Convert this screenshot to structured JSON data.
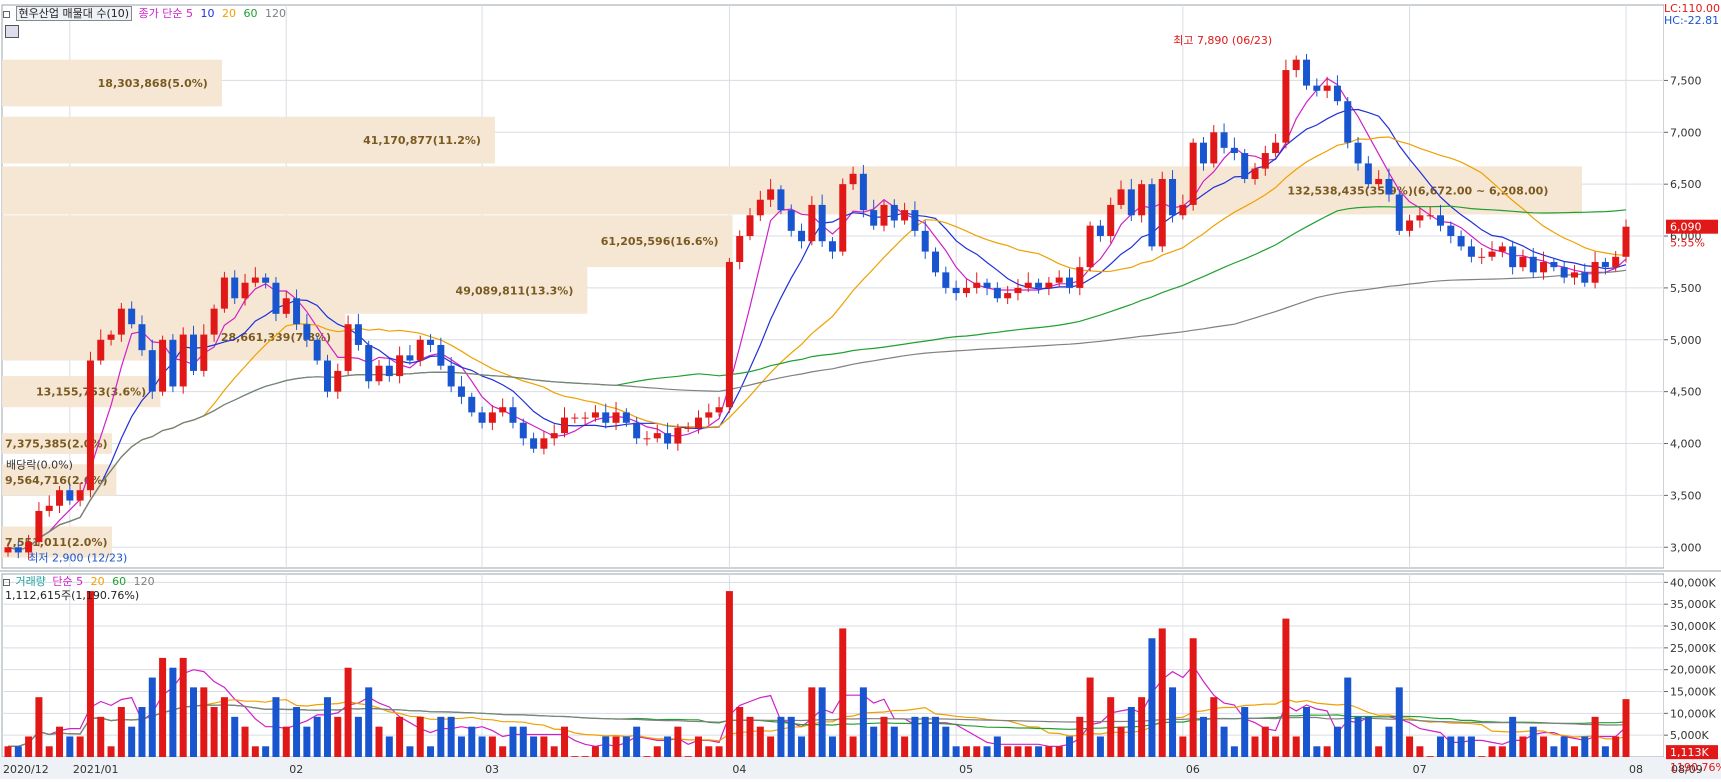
{
  "price_header": {
    "ticker": "현우산업 매물대 수(10)",
    "ma_label": "종가 단순",
    "ma_periods": [
      "5",
      "10",
      "20",
      "60",
      "120"
    ],
    "ma_colors": [
      "#d020c8",
      "#2030d8",
      "#f0a000",
      "#20a030",
      "#808080"
    ]
  },
  "volume_header": {
    "label": "거래량",
    "ma_label": "단순",
    "ma_periods": [
      "5",
      "20",
      "60",
      "120"
    ],
    "ma_colors": [
      "#d020c8",
      "#f0a000",
      "#20a030",
      "#808080"
    ],
    "last_value": "1,112,615주(1,190.76%)"
  },
  "right_top": {
    "lc": "LC:110.00",
    "hc": "HC:-22.81"
  },
  "annotations": {
    "high": "최고 7,890 (06/23)",
    "low": "최저 2,900 (12/23)",
    "dividend": "배당락(0.0%)"
  },
  "price_tag": {
    "value": "6,090",
    "pct": "5.55%"
  },
  "volume_tag": {
    "value": "1,113K",
    "pct": "1190.76%"
  },
  "x_labels": [
    "2020/12",
    "2021/01",
    "02",
    "03",
    "04",
    "05",
    "06",
    "07",
    "08",
    "08/09"
  ],
  "colors": {
    "up": "#e01818",
    "down": "#1a55d0",
    "band": "#f5e6d3",
    "grid": "#d8dde3"
  },
  "chart_data": {
    "type": "candlestick",
    "price_axis": {
      "ticks": [
        "3,000",
        "3,500",
        "4,000",
        "4,500",
        "5,000",
        "5,500",
        "6,000",
        "6,500",
        "7,000",
        "7,500"
      ],
      "range": [
        2800,
        8150
      ]
    },
    "volume_axis": {
      "ticks": [
        "5,000K",
        "10,000K",
        "15,000K",
        "20,000K",
        "25,000K",
        "30,000K",
        "35,000K",
        "40,000K"
      ],
      "range": [
        0,
        41000
      ]
    },
    "volume_profile": [
      {
        "label": "7,551,011(2.0%)",
        "low": 2900,
        "high": 3200,
        "pct": 2.0
      },
      {
        "label": "9,564,716(2.6%)",
        "low": 3500,
        "high": 3800,
        "pct": 2.6
      },
      {
        "label": "7,375,385(2.0%)",
        "low": 3900,
        "high": 4100,
        "pct": 2.0
      },
      {
        "label": "13,155,753(3.6%)",
        "low": 4350,
        "high": 4650,
        "pct": 3.6
      },
      {
        "label": "28,661,339(7.8%)",
        "low": 4800,
        "high": 5250,
        "pct": 7.8
      },
      {
        "label": "49,089,811(13.3%)",
        "low": 5250,
        "high": 5700,
        "pct": 13.3
      },
      {
        "label": "61,205,596(16.6%)",
        "low": 5700,
        "high": 6200,
        "pct": 16.6
      },
      {
        "label": "132,538,435(35.9%)(6,672.00 ~ 6,208.00)",
        "low": 6208,
        "high": 6672,
        "pct": 35.9
      },
      {
        "label": "41,170,877(11.2%)",
        "low": 6700,
        "high": 7150,
        "pct": 11.2
      },
      {
        "label": "18,303,868(5.0%)",
        "low": 7250,
        "high": 7700,
        "pct": 5.0
      }
    ],
    "prices": [
      3000,
      2950,
      3050,
      3350,
      3400,
      3550,
      3450,
      3550,
      4800,
      5000,
      5050,
      5300,
      5150,
      4900,
      4500,
      5000,
      4550,
      5050,
      4700,
      5050,
      5300,
      5600,
      5400,
      5550,
      5600,
      5550,
      5250,
      5400,
      5150,
      5000,
      4800,
      4500,
      4700,
      5150,
      4950,
      4600,
      4750,
      4650,
      4850,
      4800,
      5000,
      4950,
      4750,
      4550,
      4450,
      4300,
      4200,
      4300,
      4350,
      4200,
      4050,
      3950,
      4050,
      4100,
      4250,
      4250,
      4250,
      4300,
      4200,
      4300,
      4200,
      4050,
      4050,
      4100,
      4000,
      4150,
      4150,
      4250,
      4300,
      4350,
      5750,
      6000,
      6200,
      6350,
      6450,
      6250,
      6050,
      5950,
      6300,
      5950,
      5850,
      6500,
      6600,
      6250,
      6100,
      6300,
      6150,
      6250,
      6050,
      5850,
      5650,
      5500,
      5450,
      5500,
      5550,
      5500,
      5400,
      5450,
      5500,
      5550,
      5500,
      5550,
      5600,
      5500,
      5700,
      6100,
      6000,
      6300,
      6450,
      6200,
      6500,
      5900,
      6550,
      6200,
      6300,
      6900,
      6700,
      7000,
      6850,
      6800,
      6550,
      6650,
      6800,
      6900,
      7600,
      7700,
      7450,
      7400,
      7450,
      7300,
      6900,
      6700,
      6500,
      6550,
      6400,
      6050,
      6150,
      6200,
      6200,
      6100,
      6000,
      5900,
      5800,
      5800,
      5850,
      5900,
      5700,
      5800,
      5650,
      5750,
      5700,
      5600,
      5650,
      5550,
      5750,
      5700,
      5800,
      6090
    ]
  }
}
